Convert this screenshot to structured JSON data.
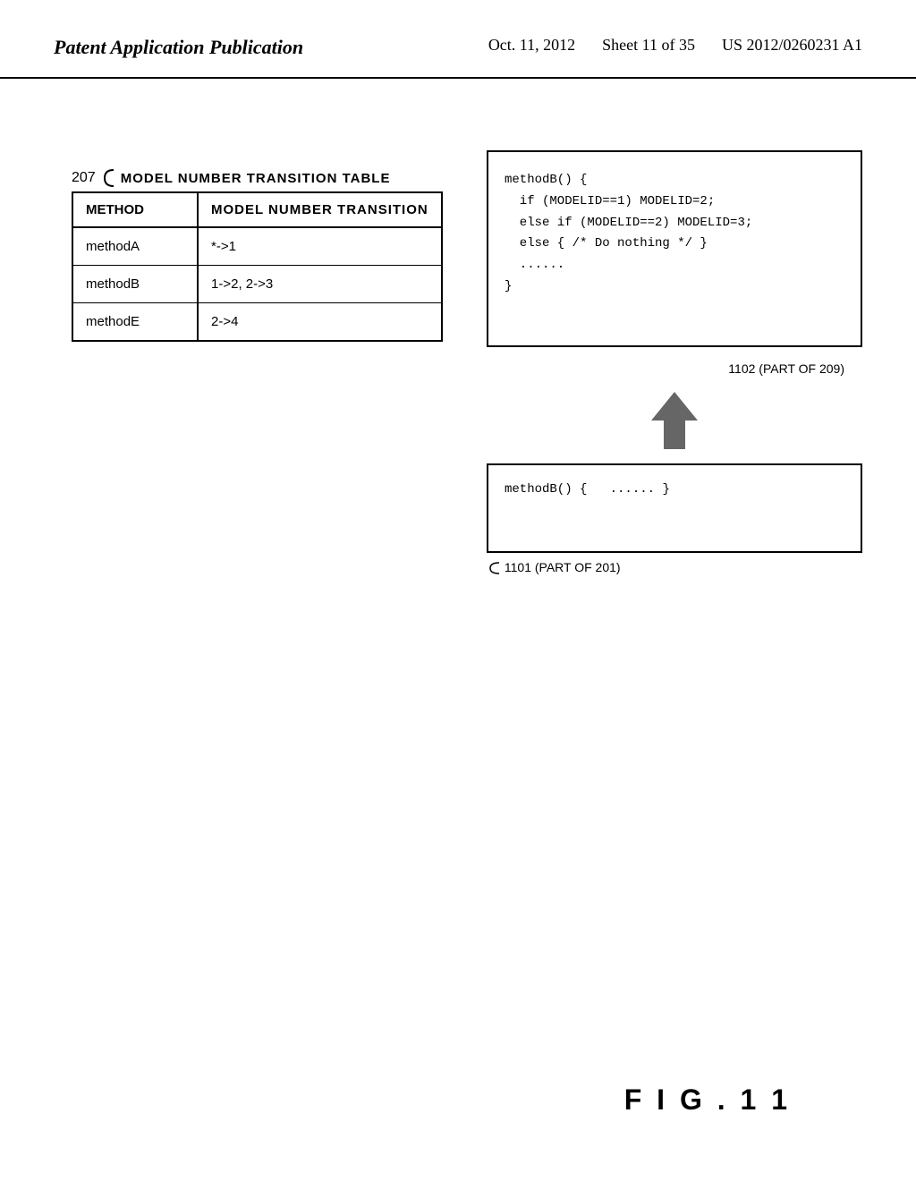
{
  "header": {
    "left": "Patent Application Publication",
    "date": "Oct. 11, 2012",
    "sheet": "Sheet 11 of 35",
    "patent_num": "US 2012/0260231 A1"
  },
  "table": {
    "id": "207",
    "title": "MODEL NUMBER TRANSITION TABLE",
    "col1_header": "METHOD",
    "col2_header": "MODEL NUMBER TRANSITION",
    "rows": [
      {
        "method": "methodA",
        "transition": "*->1"
      },
      {
        "method": "methodB",
        "transition": "1->2, 2->3"
      },
      {
        "method": "methodE",
        "transition": "2->4"
      }
    ]
  },
  "code_box_top": {
    "lines": [
      "methodB() {",
      "  if (MODELID==1) MODELID=2;",
      "  else if (MODELID==2) MODELID=3;",
      "  else { /* Do nothing */ }",
      "  ......",
      "}"
    ]
  },
  "code_box_bottom": {
    "lines": [
      "methodB() {",
      "  ......",
      "}"
    ]
  },
  "label_1101": "1101 (PART OF 201)",
  "label_1102": "1102 (PART OF 209)",
  "fig_label": "F I G .  1 1"
}
